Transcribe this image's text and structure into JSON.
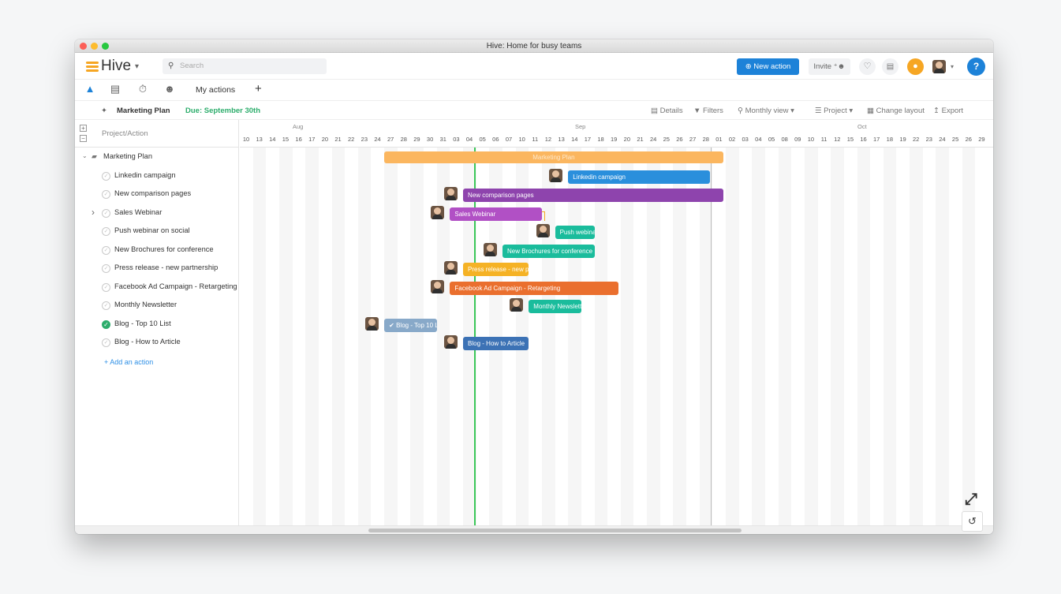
{
  "window": {
    "title": "Hive: Home for busy teams"
  },
  "topbar": {
    "logo": "Hive",
    "search_placeholder": "Search",
    "new_action": "New action",
    "invite": "Invite"
  },
  "tabs": {
    "my_actions": "My actions",
    "add": "+"
  },
  "subbar": {
    "project": "Marketing Plan",
    "due": "Due: September 30th",
    "details": "Details",
    "filters": "Filters",
    "view": "Monthly view",
    "group": "Project",
    "layout": "Change layout",
    "export": "Export"
  },
  "list": {
    "header": "Project/Action",
    "root": "Marketing Plan",
    "items": [
      {
        "label": "Linkedin campaign",
        "done": false
      },
      {
        "label": "New comparison pages",
        "done": false
      },
      {
        "label": "Sales Webinar",
        "done": false
      },
      {
        "label": "Push webinar on social",
        "done": false
      },
      {
        "label": "New Brochures for conference",
        "done": false
      },
      {
        "label": "Press release - new partnership",
        "done": false
      },
      {
        "label": "Facebook Ad Campaign - Retargeting",
        "done": false
      },
      {
        "label": "Monthly Newsletter",
        "done": false
      },
      {
        "label": "Blog - Top 10 List",
        "done": true
      },
      {
        "label": "Blog - How to Article",
        "done": false
      }
    ],
    "add_action": "+ Add an action"
  },
  "timeline": {
    "months": [
      "Aug",
      "Sep",
      "Oct"
    ],
    "days": [
      "10",
      "13",
      "14",
      "15",
      "16",
      "17",
      "20",
      "21",
      "22",
      "23",
      "24",
      "27",
      "28",
      "29",
      "30",
      "31",
      "03",
      "04",
      "05",
      "06",
      "07",
      "10",
      "11",
      "12",
      "13",
      "14",
      "17",
      "18",
      "19",
      "20",
      "21",
      "24",
      "25",
      "26",
      "27",
      "28",
      "01",
      "02",
      "03",
      "04",
      "05",
      "08",
      "09",
      "10",
      "11",
      "12",
      "15",
      "16",
      "17",
      "18",
      "19",
      "22",
      "23",
      "24",
      "25",
      "26",
      "29"
    ],
    "bars": [
      {
        "label": "Marketing Plan",
        "color": "#fbb65f",
        "start": 11,
        "end": 36.8,
        "avatar": false
      },
      {
        "label": "Linkedin campaign",
        "color": "#2a8fdc",
        "start": 25,
        "end": 35.8,
        "avatar": true
      },
      {
        "label": "New comparison pages",
        "color": "#8e44ad",
        "start": 17,
        "end": 36.8,
        "avatar": true
      },
      {
        "label": "Sales Webinar",
        "color": "#b150c5",
        "start": 16,
        "end": 23,
        "avatar": true
      },
      {
        "label": "Push webinar on social",
        "color": "#1abc9c",
        "start": 24,
        "end": 27,
        "avatar": true
      },
      {
        "label": "New Brochures for conference",
        "color": "#1abc9c",
        "start": 20,
        "end": 27,
        "avatar": true
      },
      {
        "label": "Press release - new partnership",
        "color": "#f5b225",
        "start": 17,
        "end": 22,
        "avatar": true
      },
      {
        "label": "Facebook Ad Campaign - Retargeting",
        "color": "#ea6f2e",
        "start": 16,
        "end": 28.8,
        "avatar": true
      },
      {
        "label": "Monthly Newsletter",
        "color": "#1abc9c",
        "start": 22,
        "end": 26,
        "avatar": true
      },
      {
        "label": "Blog - Top 10 List",
        "color": "#88a9c9",
        "start": 11,
        "end": 15,
        "avatar": true
      },
      {
        "label": "Blog - How to Article",
        "color": "#3c72b5",
        "start": 17,
        "end": 22,
        "avatar": true
      }
    ]
  }
}
